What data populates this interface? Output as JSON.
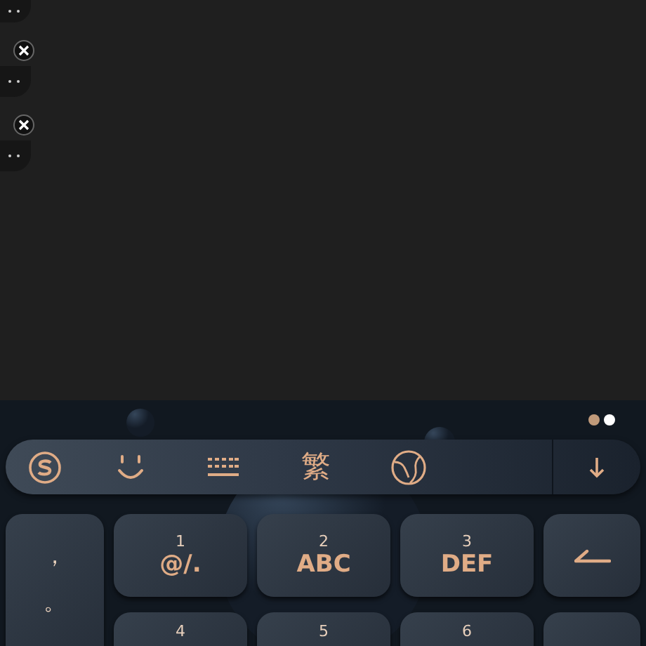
{
  "left_items": [
    {
      "closable": false
    },
    {
      "closable": true
    },
    {
      "closable": true
    }
  ],
  "pager": [
    {
      "selected": false
    },
    {
      "selected": true
    }
  ],
  "toolbar": [
    {
      "kind": "logo"
    },
    {
      "kind": "emoji"
    },
    {
      "kind": "keyboard"
    },
    {
      "kind": "text",
      "label": "繁"
    },
    {
      "kind": "globe"
    }
  ],
  "side_key": {
    "top": "，",
    "bottom": "。"
  },
  "key_rows": [
    [
      {
        "digit": "1",
        "label": "@/."
      },
      {
        "digit": "2",
        "label": "ABC"
      },
      {
        "digit": "3",
        "label": "DEF"
      }
    ],
    [
      {
        "digit": "4"
      },
      {
        "digit": "5"
      },
      {
        "digit": "6"
      }
    ]
  ]
}
